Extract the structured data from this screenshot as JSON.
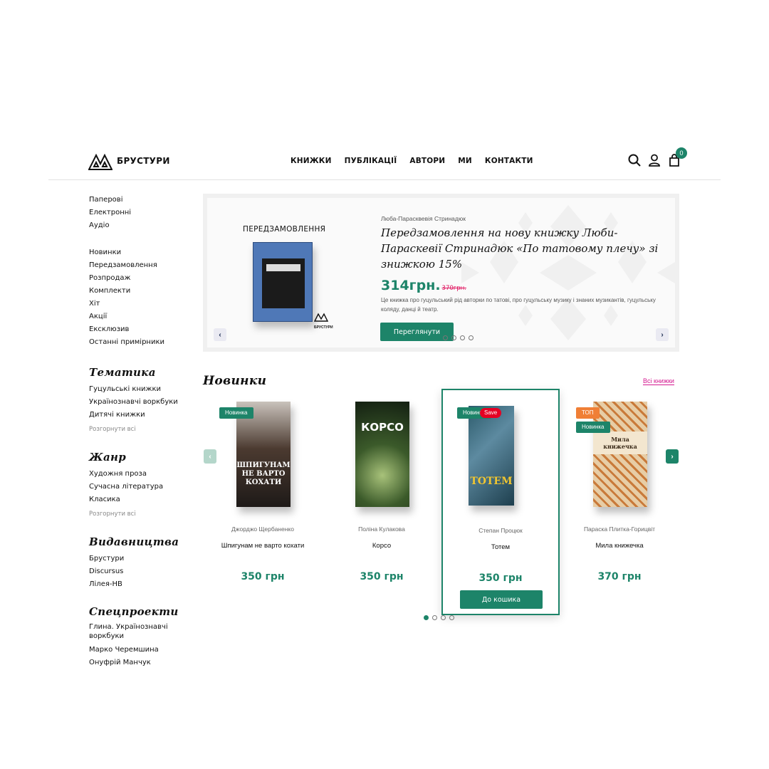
{
  "header": {
    "logo_text": "БРУСТУРИ",
    "nav": [
      "КНИЖКИ",
      "ПУБЛІКАЦІЇ",
      "АВТОРИ",
      "МИ",
      "КОНТАКТИ"
    ],
    "cart_count": "0"
  },
  "sidebar": {
    "formats": [
      "Паперові",
      "Електронні",
      "Аудіо"
    ],
    "collections": [
      "Новинки",
      "Передзамовлення",
      "Розпродаж",
      "Комплекти",
      "Хіт",
      "Акції",
      "Ексклюзив",
      "Останні примірники"
    ],
    "groups": [
      {
        "title": "Тематика",
        "items": [
          "Гуцульські книжки",
          "Українознавчі воркбуки",
          "Дитячі книжки"
        ],
        "more": "Розгорнути всі"
      },
      {
        "title": "Жанр",
        "items": [
          "Художня проза",
          "Сучасна література",
          "Класика"
        ],
        "more": "Розгорнути всі"
      },
      {
        "title": "Видавництва",
        "items": [
          "Брустури",
          "Discursus",
          "Лілея-НВ"
        ],
        "more": ""
      },
      {
        "title": "Спецпроекти",
        "items": [
          "Глина. Українознавчі воркбуки",
          "Марко Черемшина",
          "Онуфрій Манчук"
        ],
        "more": ""
      }
    ]
  },
  "hero": {
    "label": "ПЕРЕДЗАМОВЛЕННЯ",
    "book_logo": "БРУСТУРИ",
    "author": "Люба-Парасквевія Стринадюк",
    "title": "Передзамовлення на нову книжку Люби-Параскевії Стринадюк «По татовому плечу» зі знижкою 15%",
    "price": "314грн.",
    "old_price": "370грн.",
    "description": "Це книжка про гуцульський рід авторки по татові, про гуцульську музику і знаних музикантів, гуцульську коляду, данці й театр.",
    "button": "Переглянути",
    "slides": 4,
    "active_slide": 0
  },
  "novynky": {
    "title": "Новинки",
    "all_link": "Всі книжки",
    "books": [
      {
        "author": "Джорджо Щербаненко",
        "title": "Шпигунам не варто кохати",
        "cover_title": "ШПИГУНАМ НЕ ВАРТО КОХАТИ",
        "price": "350 грн",
        "badges": [
          "Новинка"
        ],
        "cover_color": "#3a2a22"
      },
      {
        "author": "Поліна Кулакова",
        "title": "Корсо",
        "cover_title": "КОРСО",
        "price": "350 грн",
        "badges": [],
        "cover_color": "#2c3b26"
      },
      {
        "author": "Степан Процюк",
        "title": "Тотем",
        "cover_title": "ТОТЕМ",
        "price": "350 грн",
        "badges": [
          "Новинка"
        ],
        "pin": "Save",
        "cover_color": "#2a4a5a",
        "button": "До кошика"
      },
      {
        "author": "Параска Плитка-Горицвіт",
        "title": "Мила книжечка",
        "cover_title": "Мила книжечка",
        "price": "370 грн",
        "badges": [
          "ТОП",
          "Новинка"
        ],
        "cover_color": "#e6c9a0"
      }
    ],
    "pages": 4,
    "active_page": 0
  },
  "colors": {
    "accent": "#1d8469",
    "link": "#d4168f",
    "old_price": "#e0105c",
    "badge_top": "#f07f36"
  }
}
